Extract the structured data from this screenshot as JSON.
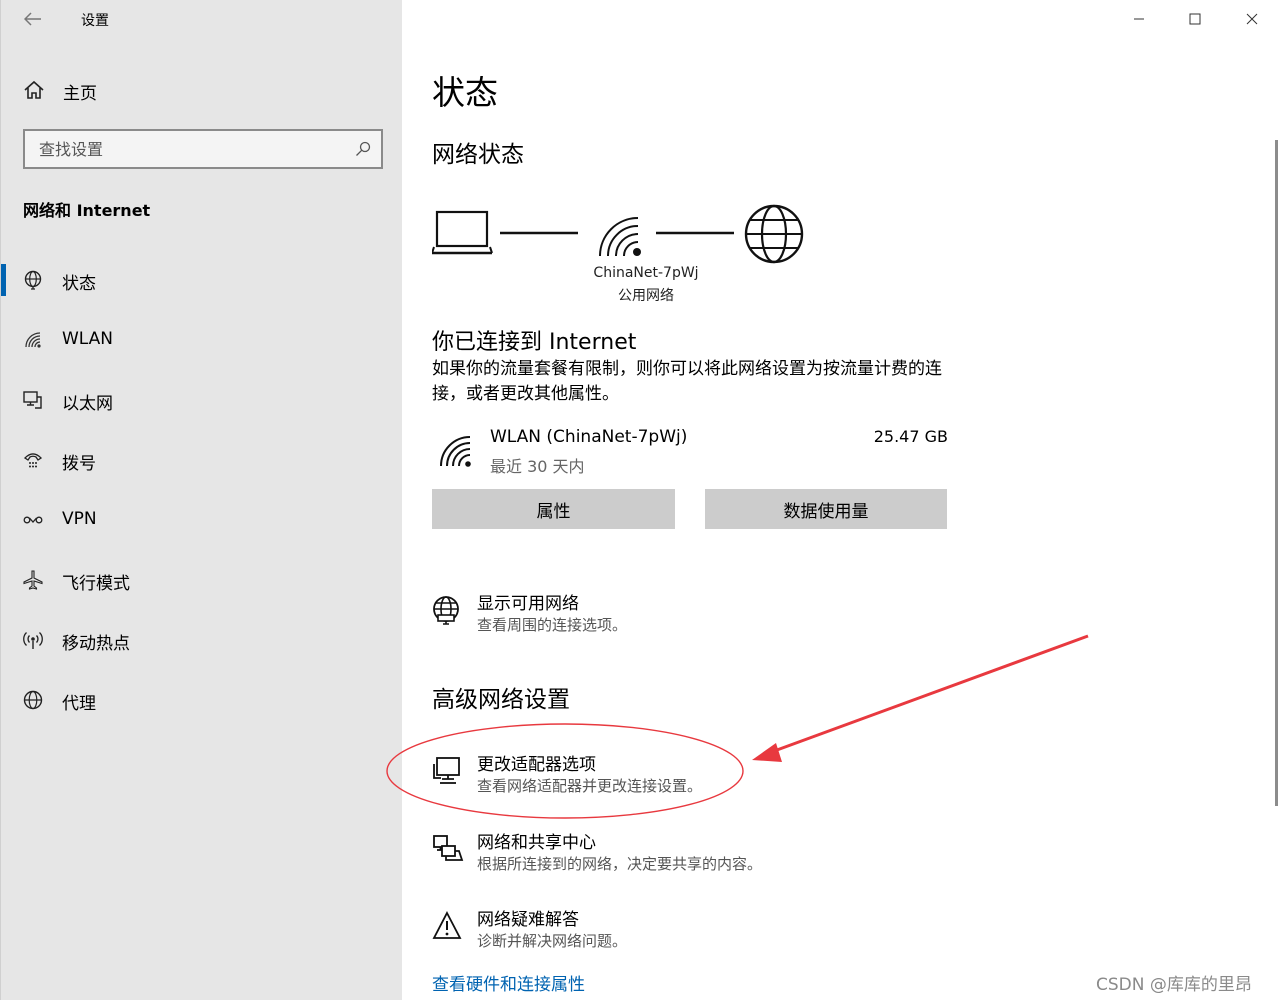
{
  "window": {
    "title": "设置"
  },
  "sidebar": {
    "home_label": "主页",
    "search_placeholder": "查找设置",
    "section_title": "网络和 Internet",
    "items": [
      {
        "label": "状态",
        "icon": "status-globe-icon",
        "active": true
      },
      {
        "label": "WLAN",
        "icon": "wifi-icon"
      },
      {
        "label": "以太网",
        "icon": "ethernet-icon"
      },
      {
        "label": "拨号",
        "icon": "dialup-icon"
      },
      {
        "label": "VPN",
        "icon": "vpn-icon"
      },
      {
        "label": "飞行模式",
        "icon": "airplane-icon"
      },
      {
        "label": "移动热点",
        "icon": "hotspot-icon"
      },
      {
        "label": "代理",
        "icon": "proxy-globe-icon"
      }
    ]
  },
  "main": {
    "title": "状态",
    "network_status_heading": "网络状态",
    "network_name": "ChinaNet-7pWj",
    "network_type": "公用网络",
    "connected_heading": "你已连接到 Internet",
    "connected_desc": "如果你的流量套餐有限制，则你可以将此网络设置为按流量计费的连接，或者更改其他属性。",
    "usage": {
      "name": "WLAN (ChinaNet-7pWj)",
      "period": "最近 30 天内",
      "amount": "25.47 GB"
    },
    "buttons": {
      "properties": "属性",
      "data_usage": "数据使用量"
    },
    "show_networks": {
      "title": "显示可用网络",
      "subtitle": "查看周围的连接选项。"
    },
    "advanced_heading": "高级网络设置",
    "advanced_items": [
      {
        "title": "更改适配器选项",
        "subtitle": "查看网络适配器并更改连接设置。"
      },
      {
        "title": "网络和共享中心",
        "subtitle": "根据所连接到的网络，决定要共享的内容。"
      },
      {
        "title": "网络疑难解答",
        "subtitle": "诊断并解决网络问题。"
      }
    ],
    "hardware_link": "查看硬件和连接属性"
  },
  "annotation": {
    "color": "#e8393f"
  },
  "watermark": "CSDN @库库的里昂",
  "colors": {
    "accent": "#0063b1",
    "sidebar_bg": "#e6e6e6",
    "button_bg": "#cccccc"
  }
}
